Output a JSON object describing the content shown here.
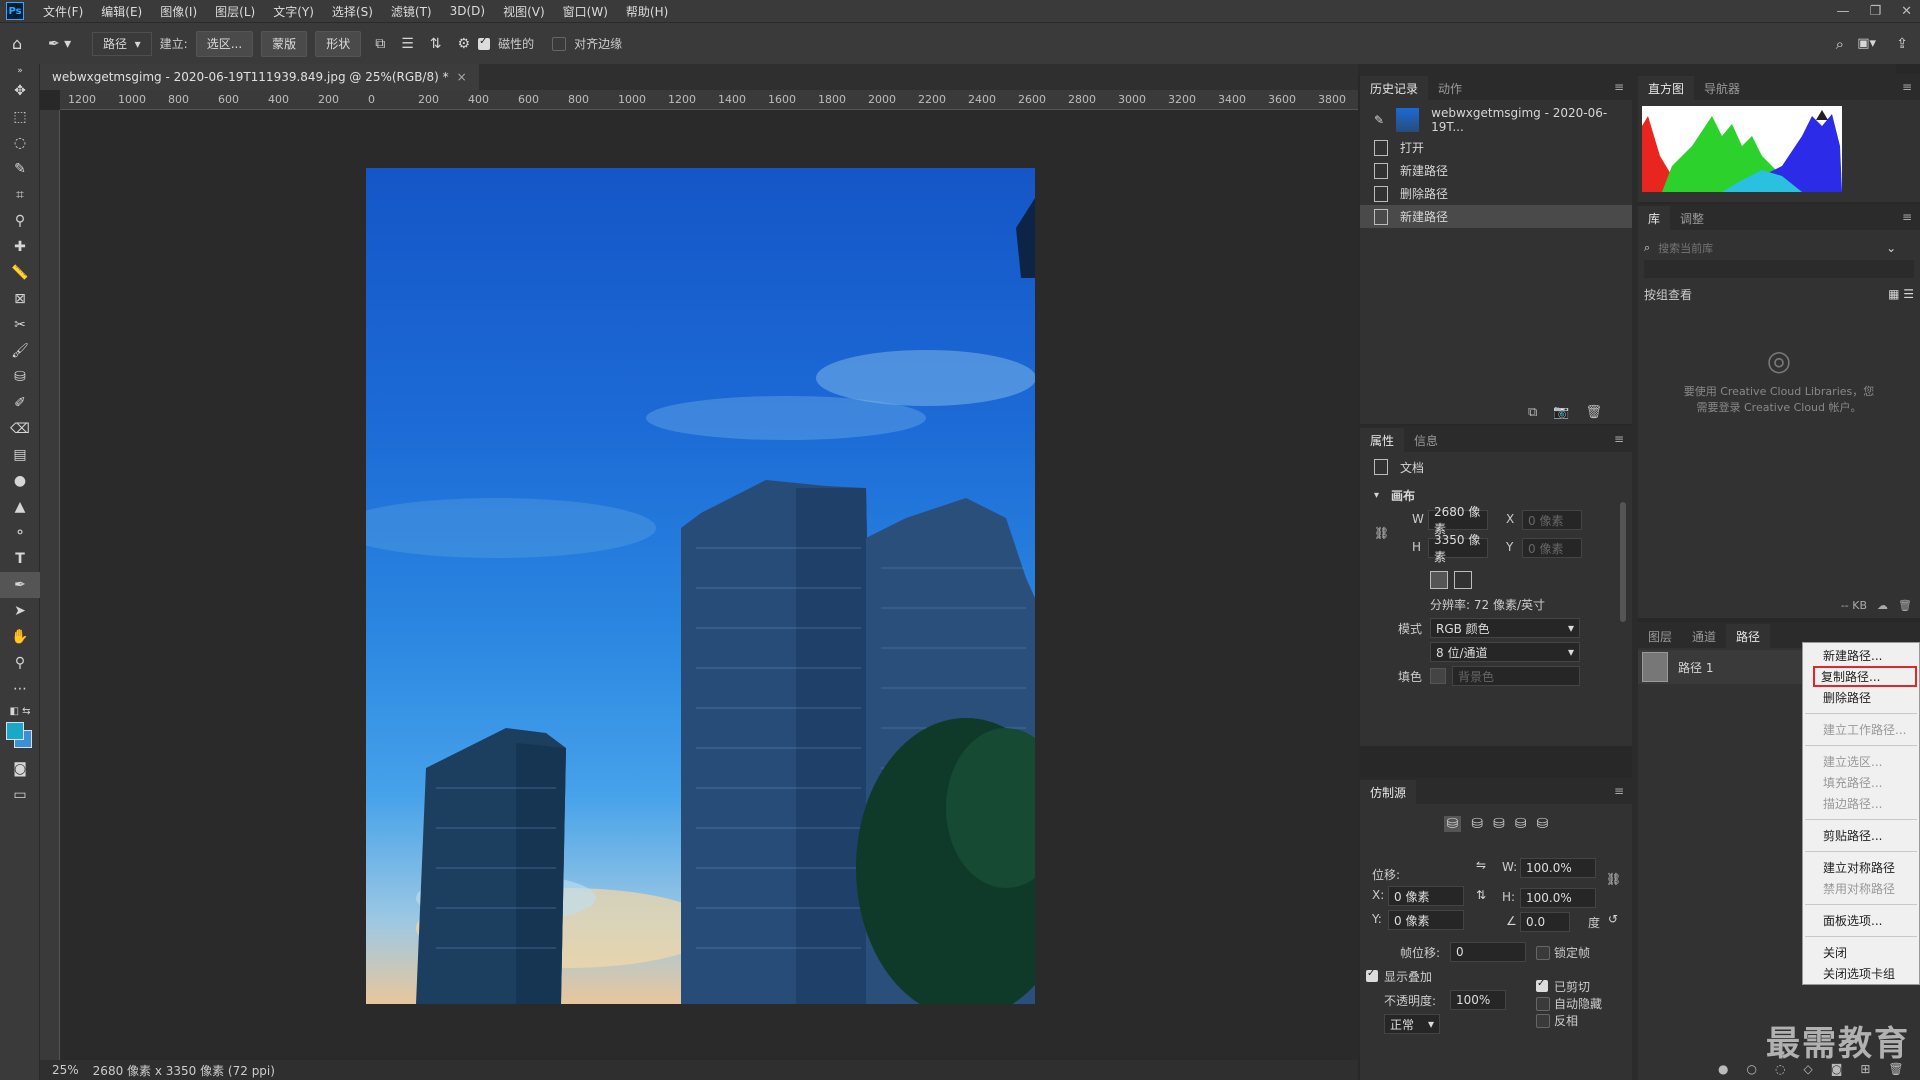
{
  "menubar": {
    "logo": "Ps",
    "items": [
      "文件(F)",
      "编辑(E)",
      "图像(I)",
      "图层(L)",
      "文字(Y)",
      "选择(S)",
      "滤镜(T)",
      "3D(D)",
      "视图(V)",
      "窗口(W)",
      "帮助(H)"
    ]
  },
  "options": {
    "mode": "路径",
    "make_label": "建立:",
    "selection_btn": "选区...",
    "mask_btn": "蒙版",
    "shape_btn": "形状",
    "magnetic_label": "磁性的",
    "align_edges_label": "对齐边缘"
  },
  "document": {
    "tab_title": "webwxgetmsgimg - 2020-06-19T111939.849.jpg @ 25%(RGB/8) *",
    "close": "×",
    "ruler_labels": [
      "1200",
      "1000",
      "800",
      "600",
      "400",
      "200",
      "0",
      "200",
      "400",
      "600",
      "800",
      "1000",
      "1200",
      "1400",
      "1600",
      "1800",
      "2000",
      "2200",
      "2400",
      "2600",
      "2800",
      "3000",
      "3200",
      "3400",
      "3600",
      "3800"
    ],
    "status_zoom": "25%",
    "status_info": "2680 像素 x 3350 像素 (72 ppi)"
  },
  "history": {
    "tabs": [
      "历史记录",
      "动作"
    ],
    "snapshot": "webwxgetmsgimg - 2020-06-19T...",
    "items": [
      "打开",
      "新建路径",
      "删除路径",
      "新建路径"
    ]
  },
  "properties": {
    "tabs": [
      "属性",
      "信息"
    ],
    "doc_label": "文档",
    "canvas_section": "画布",
    "w_label": "W",
    "w_value": "2680 像素",
    "h_label": "H",
    "h_value": "3350 像素",
    "x_label": "X",
    "x_value": "0 像素",
    "y_label": "Y",
    "y_value": "0 像素",
    "resolution": "分辨率: 72 像素/英寸",
    "mode_label": "模式",
    "mode_value": "RGB 颜色",
    "depth_value": "8 位/通道",
    "fill_label": "填色",
    "fill_value": "背景色"
  },
  "clone": {
    "tab": "仿制源",
    "offset_label": "位移:",
    "w_label": "W:",
    "w_value": "100.0%",
    "h_label": "H:",
    "h_value": "100.0%",
    "x_label": "X:",
    "x_value": "0 像素",
    "y_label": "Y:",
    "y_value": "0 像素",
    "angle_value": "0.0",
    "deg": "度",
    "frame_offset_label": "帧位移:",
    "frame_offset_value": "0",
    "lock_frame": "锁定帧",
    "show_overlay": "显示叠加",
    "opacity_label": "不透明度:",
    "opacity_value": "100%",
    "clipped": "已剪切",
    "auto_hide": "自动隐藏",
    "invert": "反相",
    "blend_mode": "正常"
  },
  "histogram": {
    "tabs": [
      "直方图",
      "导航器"
    ]
  },
  "library": {
    "tabs": [
      "库",
      "调整"
    ],
    "search_placeholder": "搜索当前库",
    "view_by": "按组查看",
    "message_line1": "要使用 Creative Cloud Libraries，您",
    "message_line2": "需要登录 Creative Cloud 帐户。",
    "kb": "-- KB"
  },
  "paths": {
    "tabs": [
      "图层",
      "通道",
      "路径"
    ],
    "path_name": "路径 1"
  },
  "context_menu": {
    "items": [
      {
        "label": "新建路径...",
        "enabled": true
      },
      {
        "label": "复制路径...",
        "enabled": true,
        "highlight": true
      },
      {
        "label": "删除路径",
        "enabled": true
      },
      {
        "sep": true
      },
      {
        "label": "建立工作路径...",
        "enabled": false
      },
      {
        "sep": true
      },
      {
        "label": "建立选区...",
        "enabled": false
      },
      {
        "label": "填充路径...",
        "enabled": false
      },
      {
        "label": "描边路径...",
        "enabled": false
      },
      {
        "sep": true
      },
      {
        "label": "剪贴路径...",
        "enabled": true
      },
      {
        "sep": true
      },
      {
        "label": "建立对称路径",
        "enabled": true
      },
      {
        "label": "禁用对称路径",
        "enabled": false
      },
      {
        "sep": true
      },
      {
        "label": "面板选项...",
        "enabled": true
      },
      {
        "sep": true
      },
      {
        "label": "关闭",
        "enabled": true
      },
      {
        "label": "关闭选项卡组",
        "enabled": true
      }
    ]
  },
  "watermark": "最需教育",
  "colors": {
    "fg": "#1aa8c9",
    "bg": "#3b8ed8",
    "accent_red": "#e0252b"
  }
}
